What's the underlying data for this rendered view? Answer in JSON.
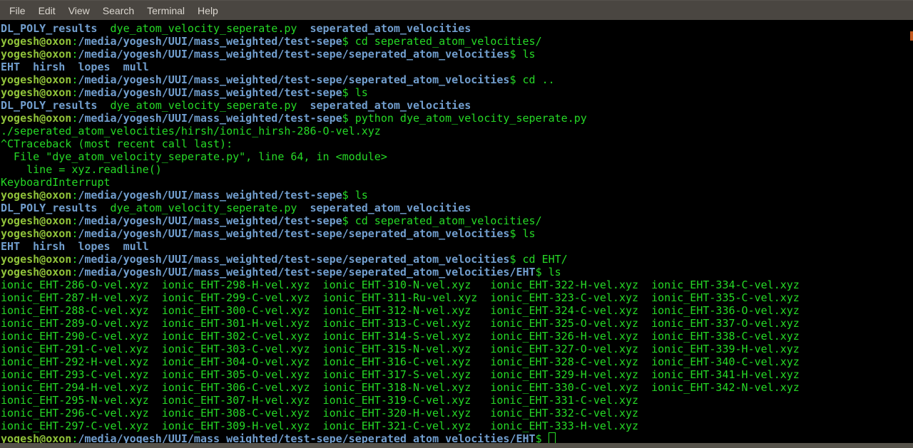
{
  "menu_bar": {
    "items": [
      "File",
      "Edit",
      "View",
      "Search",
      "Terminal",
      "Help"
    ]
  },
  "colors": {
    "terminal_background": "#000000",
    "default_text_green": "#26d926",
    "directory_blue": "#729fcf",
    "prompt_user_green": "#90c33a",
    "menubar_gray": "#4a4641",
    "scrollbar_orange": "#c45a1e",
    "bottom_strip_gray": "#56534b"
  },
  "terminal": {
    "prompt_user": "yogesh@oxon",
    "cursor_style": "hollow-box",
    "lines": [
      {
        "segs": [
          [
            "dir",
            "DL_POLY_results"
          ],
          [
            "fg",
            "  dye_atom_velocity_seperate.py  "
          ],
          [
            "dir",
            "seperated_atom_velocities"
          ]
        ]
      },
      {
        "segs": [
          [
            "user",
            "yogesh@oxon"
          ],
          [
            "fg",
            ":"
          ],
          [
            "path",
            "/media/yogesh/UUI/mass_weighted/test-sepe"
          ],
          [
            "fg",
            "$ cd seperated_atom_velocities/"
          ]
        ]
      },
      {
        "segs": [
          [
            "user",
            "yogesh@oxon"
          ],
          [
            "fg",
            ":"
          ],
          [
            "path",
            "/media/yogesh/UUI/mass_weighted/test-sepe/seperated_atom_velocities"
          ],
          [
            "fg",
            "$ ls"
          ]
        ]
      },
      {
        "segs": [
          [
            "dir",
            "EHT"
          ],
          [
            "fg",
            "  "
          ],
          [
            "dir",
            "hirsh"
          ],
          [
            "fg",
            "  "
          ],
          [
            "dir",
            "lopes"
          ],
          [
            "fg",
            "  "
          ],
          [
            "dir",
            "mull"
          ]
        ]
      },
      {
        "segs": [
          [
            "user",
            "yogesh@oxon"
          ],
          [
            "fg",
            ":"
          ],
          [
            "path",
            "/media/yogesh/UUI/mass_weighted/test-sepe/seperated_atom_velocities"
          ],
          [
            "fg",
            "$ cd .."
          ]
        ]
      },
      {
        "segs": [
          [
            "user",
            "yogesh@oxon"
          ],
          [
            "fg",
            ":"
          ],
          [
            "path",
            "/media/yogesh/UUI/mass_weighted/test-sepe"
          ],
          [
            "fg",
            "$ ls"
          ]
        ]
      },
      {
        "segs": [
          [
            "dir",
            "DL_POLY_results"
          ],
          [
            "fg",
            "  dye_atom_velocity_seperate.py  "
          ],
          [
            "dir",
            "seperated_atom_velocities"
          ]
        ]
      },
      {
        "segs": [
          [
            "user",
            "yogesh@oxon"
          ],
          [
            "fg",
            ":"
          ],
          [
            "path",
            "/media/yogesh/UUI/mass_weighted/test-sepe"
          ],
          [
            "fg",
            "$ python dye_atom_velocity_seperate.py"
          ]
        ]
      },
      {
        "segs": [
          [
            "fg",
            "./seperated_atom_velocities/hirsh/ionic_hirsh-286-O-vel.xyz"
          ]
        ]
      },
      {
        "segs": [
          [
            "fg",
            "^CTraceback (most recent call last):"
          ]
        ]
      },
      {
        "segs": [
          [
            "fg",
            "  File \"dye_atom_velocity_seperate.py\", line 64, in <module>"
          ]
        ]
      },
      {
        "segs": [
          [
            "fg",
            "    line = xyz.readline()"
          ]
        ]
      },
      {
        "segs": [
          [
            "fg",
            "KeyboardInterrupt"
          ]
        ]
      },
      {
        "segs": [
          [
            "user",
            "yogesh@oxon"
          ],
          [
            "fg",
            ":"
          ],
          [
            "path",
            "/media/yogesh/UUI/mass_weighted/test-sepe"
          ],
          [
            "fg",
            "$ ls"
          ]
        ]
      },
      {
        "segs": [
          [
            "dir",
            "DL_POLY_results"
          ],
          [
            "fg",
            "  dye_atom_velocity_seperate.py  "
          ],
          [
            "dir",
            "seperated_atom_velocities"
          ]
        ]
      },
      {
        "segs": [
          [
            "user",
            "yogesh@oxon"
          ],
          [
            "fg",
            ":"
          ],
          [
            "path",
            "/media/yogesh/UUI/mass_weighted/test-sepe"
          ],
          [
            "fg",
            "$ cd seperated_atom_velocities/"
          ]
        ]
      },
      {
        "segs": [
          [
            "user",
            "yogesh@oxon"
          ],
          [
            "fg",
            ":"
          ],
          [
            "path",
            "/media/yogesh/UUI/mass_weighted/test-sepe/seperated_atom_velocities"
          ],
          [
            "fg",
            "$ ls"
          ]
        ]
      },
      {
        "segs": [
          [
            "dir",
            "EHT"
          ],
          [
            "fg",
            "  "
          ],
          [
            "dir",
            "hirsh"
          ],
          [
            "fg",
            "  "
          ],
          [
            "dir",
            "lopes"
          ],
          [
            "fg",
            "  "
          ],
          [
            "dir",
            "mull"
          ]
        ]
      },
      {
        "segs": [
          [
            "user",
            "yogesh@oxon"
          ],
          [
            "fg",
            ":"
          ],
          [
            "path",
            "/media/yogesh/UUI/mass_weighted/test-sepe/seperated_atom_velocities"
          ],
          [
            "fg",
            "$ cd EHT/"
          ]
        ]
      },
      {
        "segs": [
          [
            "user",
            "yogesh@oxon"
          ],
          [
            "fg",
            ":"
          ],
          [
            "path",
            "/media/yogesh/UUI/mass_weighted/test-sepe/seperated_atom_velocities/EHT"
          ],
          [
            "fg",
            "$ ls"
          ]
        ]
      },
      {
        "segs": [
          [
            "fg",
            "ionic_EHT-286-O-vel.xyz  ionic_EHT-298-H-vel.xyz  ionic_EHT-310-N-vel.xyz   ionic_EHT-322-H-vel.xyz  ionic_EHT-334-C-vel.xyz"
          ]
        ]
      },
      {
        "segs": [
          [
            "fg",
            "ionic_EHT-287-H-vel.xyz  ionic_EHT-299-C-vel.xyz  ionic_EHT-311-Ru-vel.xyz  ionic_EHT-323-C-vel.xyz  ionic_EHT-335-C-vel.xyz"
          ]
        ]
      },
      {
        "segs": [
          [
            "fg",
            "ionic_EHT-288-C-vel.xyz  ionic_EHT-300-C-vel.xyz  ionic_EHT-312-N-vel.xyz   ionic_EHT-324-C-vel.xyz  ionic_EHT-336-O-vel.xyz"
          ]
        ]
      },
      {
        "segs": [
          [
            "fg",
            "ionic_EHT-289-O-vel.xyz  ionic_EHT-301-H-vel.xyz  ionic_EHT-313-C-vel.xyz   ionic_EHT-325-O-vel.xyz  ionic_EHT-337-O-vel.xyz"
          ]
        ]
      },
      {
        "segs": [
          [
            "fg",
            "ionic_EHT-290-C-vel.xyz  ionic_EHT-302-C-vel.xyz  ionic_EHT-314-S-vel.xyz   ionic_EHT-326-H-vel.xyz  ionic_EHT-338-C-vel.xyz"
          ]
        ]
      },
      {
        "segs": [
          [
            "fg",
            "ionic_EHT-291-C-vel.xyz  ionic_EHT-303-C-vel.xyz  ionic_EHT-315-N-vel.xyz   ionic_EHT-327-O-vel.xyz  ionic_EHT-339-H-vel.xyz"
          ]
        ]
      },
      {
        "segs": [
          [
            "fg",
            "ionic_EHT-292-H-vel.xyz  ionic_EHT-304-O-vel.xyz  ionic_EHT-316-C-vel.xyz   ionic_EHT-328-C-vel.xyz  ionic_EHT-340-C-vel.xyz"
          ]
        ]
      },
      {
        "segs": [
          [
            "fg",
            "ionic_EHT-293-C-vel.xyz  ionic_EHT-305-O-vel.xyz  ionic_EHT-317-S-vel.xyz   ionic_EHT-329-H-vel.xyz  ionic_EHT-341-H-vel.xyz"
          ]
        ]
      },
      {
        "segs": [
          [
            "fg",
            "ionic_EHT-294-H-vel.xyz  ionic_EHT-306-C-vel.xyz  ionic_EHT-318-N-vel.xyz   ionic_EHT-330-C-vel.xyz  ionic_EHT-342-N-vel.xyz"
          ]
        ]
      },
      {
        "segs": [
          [
            "fg",
            "ionic_EHT-295-N-vel.xyz  ionic_EHT-307-H-vel.xyz  ionic_EHT-319-C-vel.xyz   ionic_EHT-331-C-vel.xyz"
          ]
        ]
      },
      {
        "segs": [
          [
            "fg",
            "ionic_EHT-296-C-vel.xyz  ionic_EHT-308-C-vel.xyz  ionic_EHT-320-H-vel.xyz   ionic_EHT-332-C-vel.xyz"
          ]
        ]
      },
      {
        "segs": [
          [
            "fg",
            "ionic_EHT-297-C-vel.xyz  ionic_EHT-309-H-vel.xyz  ionic_EHT-321-C-vel.xyz   ionic_EHT-333-H-vel.xyz"
          ]
        ]
      },
      {
        "segs": [
          [
            "user",
            "yogesh@oxon"
          ],
          [
            "fg",
            ":"
          ],
          [
            "path",
            "/media/yogesh/UUI/mass_weighted/test-sepe/seperated_atom_velocities/EHT"
          ],
          [
            "fg",
            "$ "
          ]
        ],
        "cursor": true
      }
    ]
  }
}
